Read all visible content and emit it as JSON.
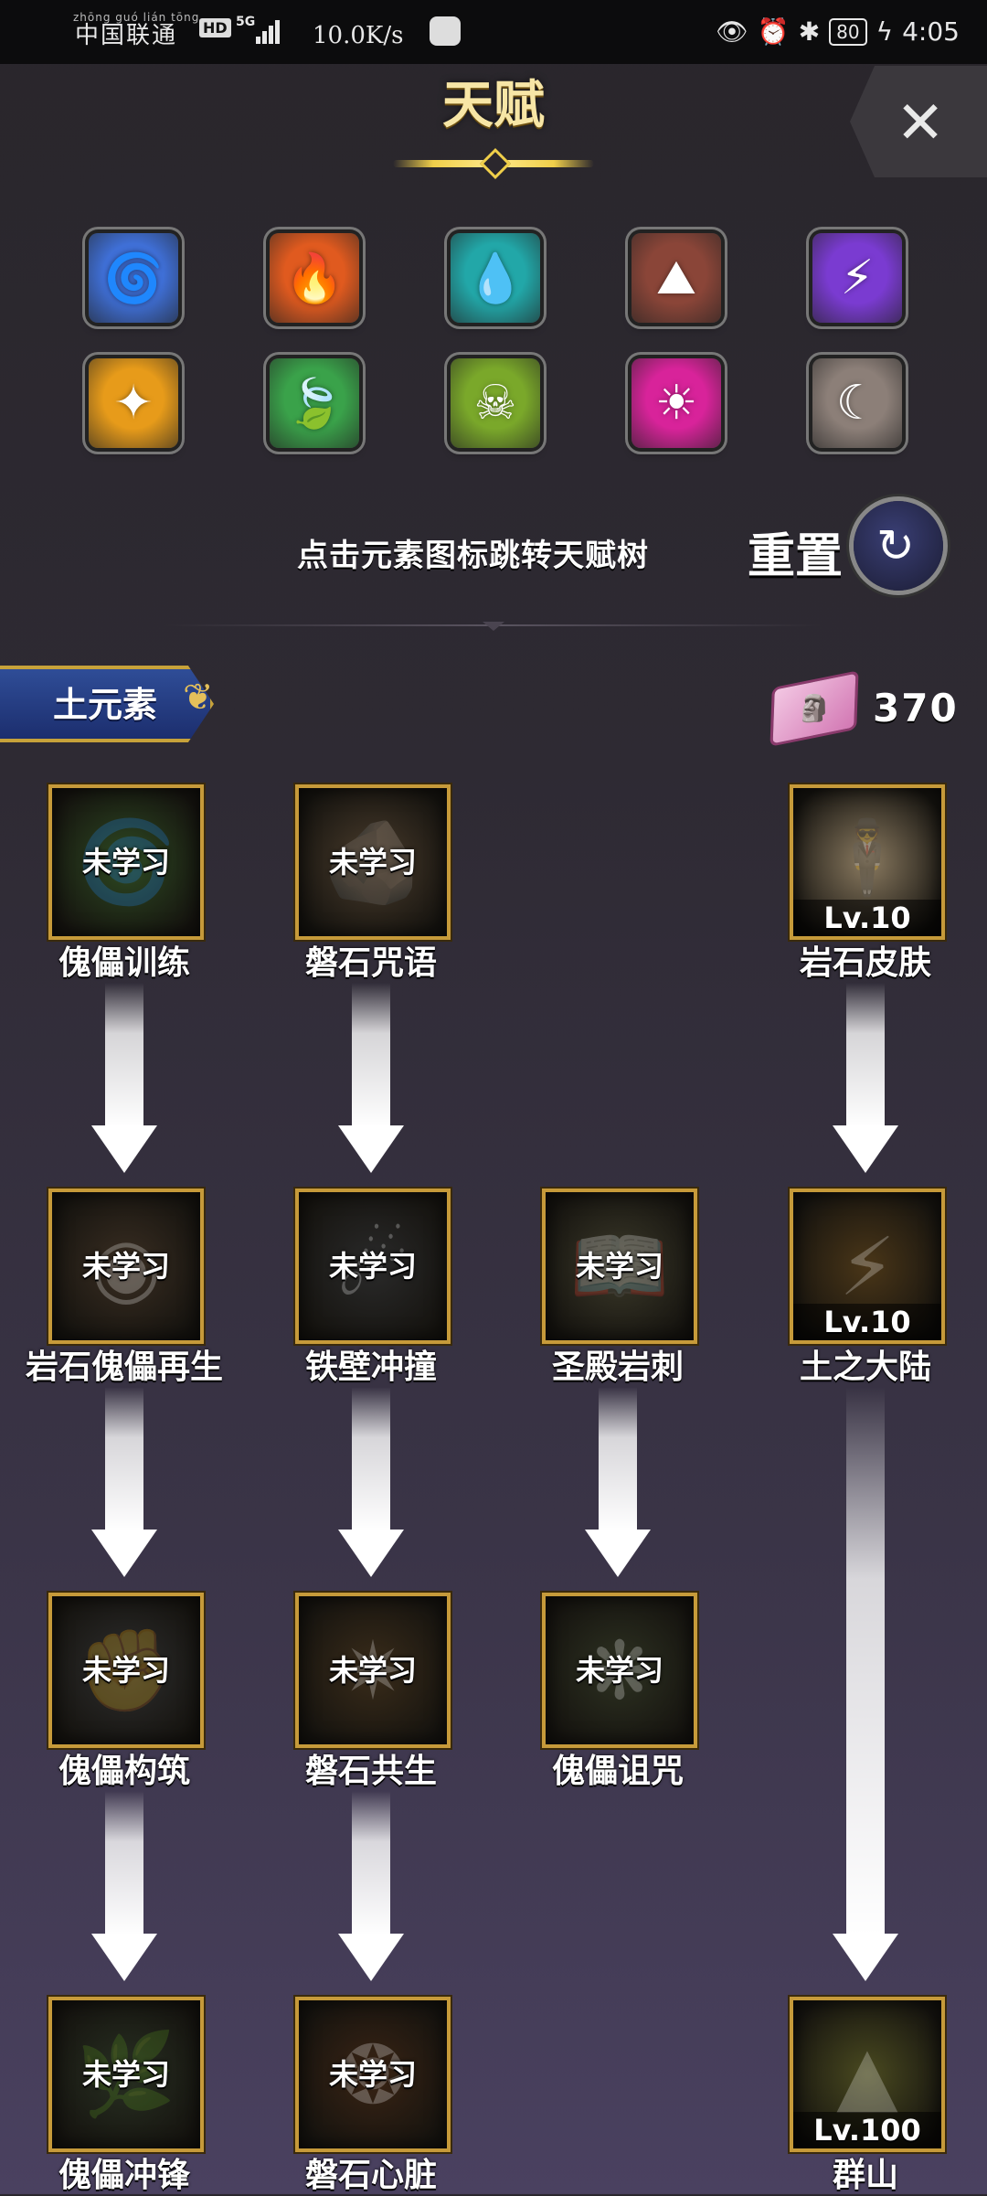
{
  "status_bar": {
    "carrier": "中国联通",
    "carrier_pinyin": "zhōng guó lián tōng",
    "hd": "HD",
    "network": "5G",
    "speed": "10.0K/s",
    "battery": "80",
    "time": "4:05"
  },
  "header": {
    "title": "天赋",
    "close_icon": "✕"
  },
  "elements": [
    {
      "name": "wind",
      "icon": "🌀",
      "color": "#3f6fd6"
    },
    {
      "name": "fire",
      "icon": "🔥",
      "color": "#e05a1f"
    },
    {
      "name": "water",
      "icon": "💧",
      "color": "#22a7a8"
    },
    {
      "name": "earth",
      "icon": "⛰",
      "color": "#8a4538"
    },
    {
      "name": "thunder",
      "icon": "⚡",
      "color": "#7a3bd1"
    },
    {
      "name": "light",
      "icon": "✦",
      "color": "#e79b1a"
    },
    {
      "name": "nature",
      "icon": "🍃",
      "color": "#3aa24a"
    },
    {
      "name": "poison",
      "icon": "☠",
      "color": "#7aa82a"
    },
    {
      "name": "holy",
      "icon": "☀",
      "color": "#d8239a"
    },
    {
      "name": "dark",
      "icon": "☾",
      "color": "#8c7f78"
    }
  ],
  "hint": "点击元素图标跳转天赋树",
  "reset": {
    "label": "重置",
    "icon": "↻"
  },
  "tree": {
    "tag": "土元素",
    "tag_ornament": "❦",
    "points_icon": "🗿",
    "points": "370",
    "nodes": [
      {
        "name": "傀儡训练",
        "status": "未学习",
        "level": "",
        "glyph": "🌀",
        "tint": "#2e4a22"
      },
      {
        "name": "磐石咒语",
        "status": "未学习",
        "level": "",
        "glyph": "🪨",
        "tint": "#4a3c2c"
      },
      {
        "name": "岩石皮肤",
        "status": "",
        "level": "Lv.10",
        "glyph": "🕴",
        "tint": "#8a7a60"
      },
      {
        "name": "岩石傀儡再生",
        "status": "未学习",
        "level": "",
        "glyph": "◉",
        "tint": "#3a2e22"
      },
      {
        "name": "铁壁冲撞",
        "status": "未学习",
        "level": "",
        "glyph": "☄",
        "tint": "#2a2a2a"
      },
      {
        "name": "圣殿岩刺",
        "status": "未学习",
        "level": "",
        "glyph": "📖",
        "tint": "#3c3a2a"
      },
      {
        "name": "土之大陆",
        "status": "",
        "level": "Lv.10",
        "glyph": "⚡",
        "tint": "#4a3618"
      },
      {
        "name": "傀儡构筑",
        "status": "未学习",
        "level": "",
        "glyph": "✊",
        "tint": "#2e2e2e"
      },
      {
        "name": "磐石共生",
        "status": "未学习",
        "level": "",
        "glyph": "✷",
        "tint": "#3a2c1a"
      },
      {
        "name": "傀儡诅咒",
        "status": "未学习",
        "level": "",
        "glyph": "❋",
        "tint": "#2e3222"
      },
      {
        "name": "傀儡冲锋",
        "status": "未学习",
        "level": "",
        "glyph": "🌿",
        "tint": "#283022"
      },
      {
        "name": "磐石心脏",
        "status": "未学习",
        "level": "",
        "glyph": "❂",
        "tint": "#3a2414"
      },
      {
        "name": "群山",
        "status": "",
        "level": "Lv.100",
        "glyph": "▲",
        "tint": "#4a4a20"
      }
    ]
  }
}
